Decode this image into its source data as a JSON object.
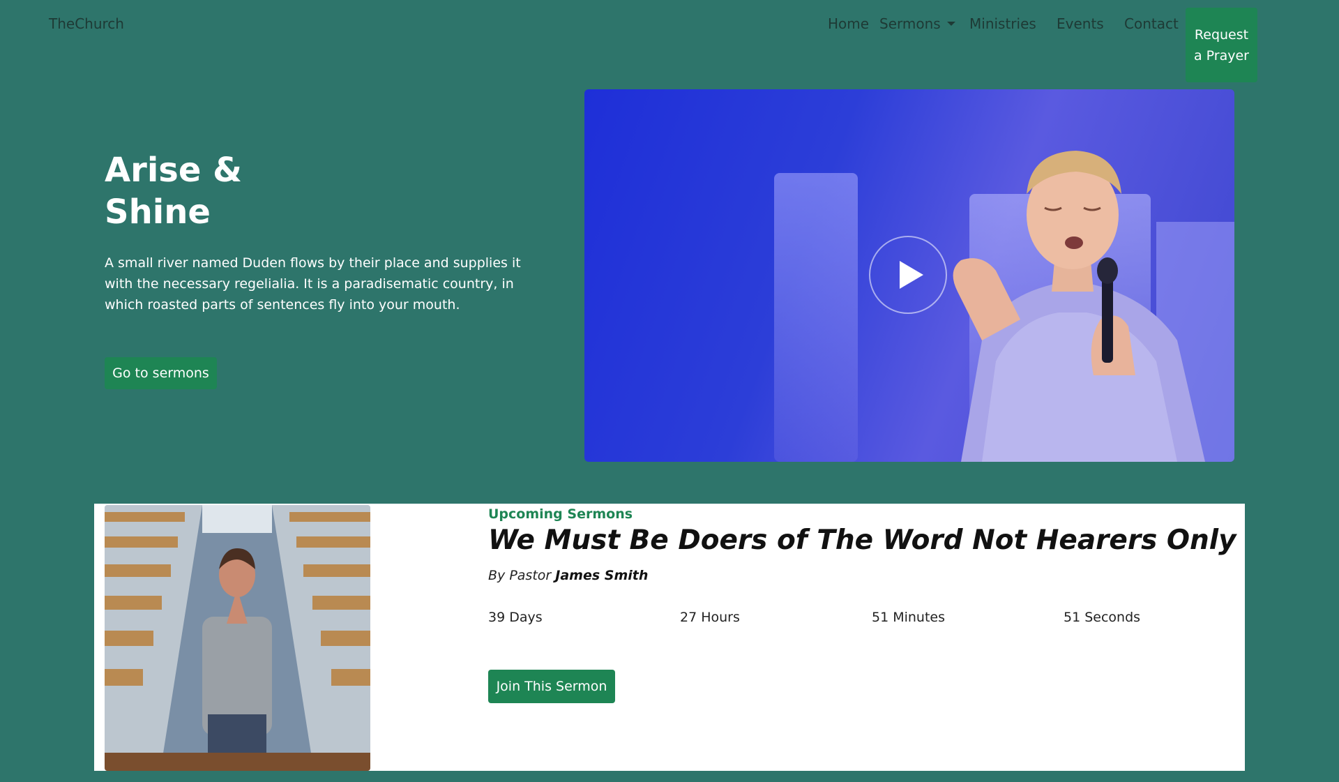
{
  "navbar": {
    "brand": "TheChurch",
    "items": [
      {
        "label": "Home"
      },
      {
        "label": "Sermons",
        "icon": "caret-down-icon"
      },
      {
        "label": "Ministries"
      },
      {
        "label": "Events"
      },
      {
        "label": "Contact"
      }
    ],
    "cta_label": "Request a Prayer"
  },
  "hero": {
    "title": "Arise & Shine",
    "description": "A small river named Duden flows by their place and supplies it with the necessary regelialia. It is a paradisematic country, in which roasted parts of sentences fly into your mouth.",
    "button_label": "Go to sermons",
    "video_icon": "play-icon"
  },
  "sermon": {
    "eyebrow": "Upcoming Sermons",
    "title": "We Must Be Doers of The Word Not Hearers Only",
    "by_prefix": "By Pastor",
    "pastor": "James Smith",
    "countdown": {
      "days": "39 Days",
      "hours": "27 Hours",
      "minutes": "51 Minutes",
      "seconds": "51 Seconds"
    },
    "button_label": "Join This Sermon"
  },
  "colors": {
    "background": "#2e756b",
    "accent": "#1e8554",
    "nav_text": "#1e3a35"
  }
}
